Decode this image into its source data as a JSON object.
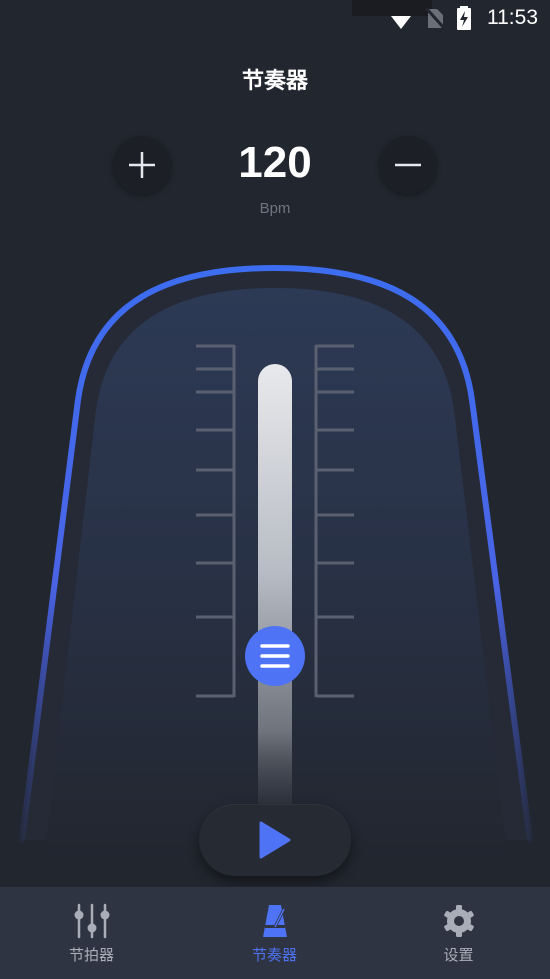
{
  "status_bar": {
    "time": "11:53",
    "icons": [
      "notification-icons",
      "wifi-icon",
      "no-sim-icon",
      "battery-charging-icon"
    ]
  },
  "app": {
    "title": "节奏器"
  },
  "tempo": {
    "value": "120",
    "unit": "Bpm",
    "increase_icon": "plus-icon",
    "decrease_icon": "minus-icon"
  },
  "metronome": {
    "slider_icon": "hamburger-menu-icon",
    "accent_color": "#4e73f5",
    "play_icon": "play-icon"
  },
  "bottom_nav": {
    "items": [
      {
        "label": "节拍器",
        "icon": "sliders-icon",
        "active": false
      },
      {
        "label": "节奏器",
        "icon": "metronome-icon",
        "active": true
      },
      {
        "label": "设置",
        "icon": "gear-icon",
        "active": false
      }
    ],
    "active_color": "#4e73f5",
    "inactive_color": "#a8adb8"
  }
}
